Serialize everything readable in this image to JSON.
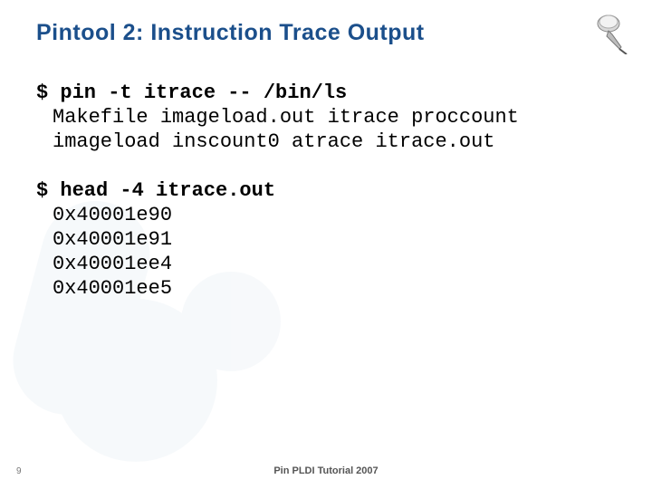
{
  "title": "Pintool 2: Instruction Trace Output",
  "icon": "pushpin-icon",
  "block1": {
    "cmd": "$ pin -t itrace -- /bin/ls",
    "out1": "Makefile imageload.out itrace proccount",
    "out2": "imageload inscount0 atrace itrace.out"
  },
  "block2": {
    "cmd": "$ head -4 itrace.out",
    "l1": "0x40001e90",
    "l2": "0x40001e91",
    "l3": "0x40001ee4",
    "l4": "0x40001ee5"
  },
  "page_number": "9",
  "footer": "Pin PLDI Tutorial 2007"
}
